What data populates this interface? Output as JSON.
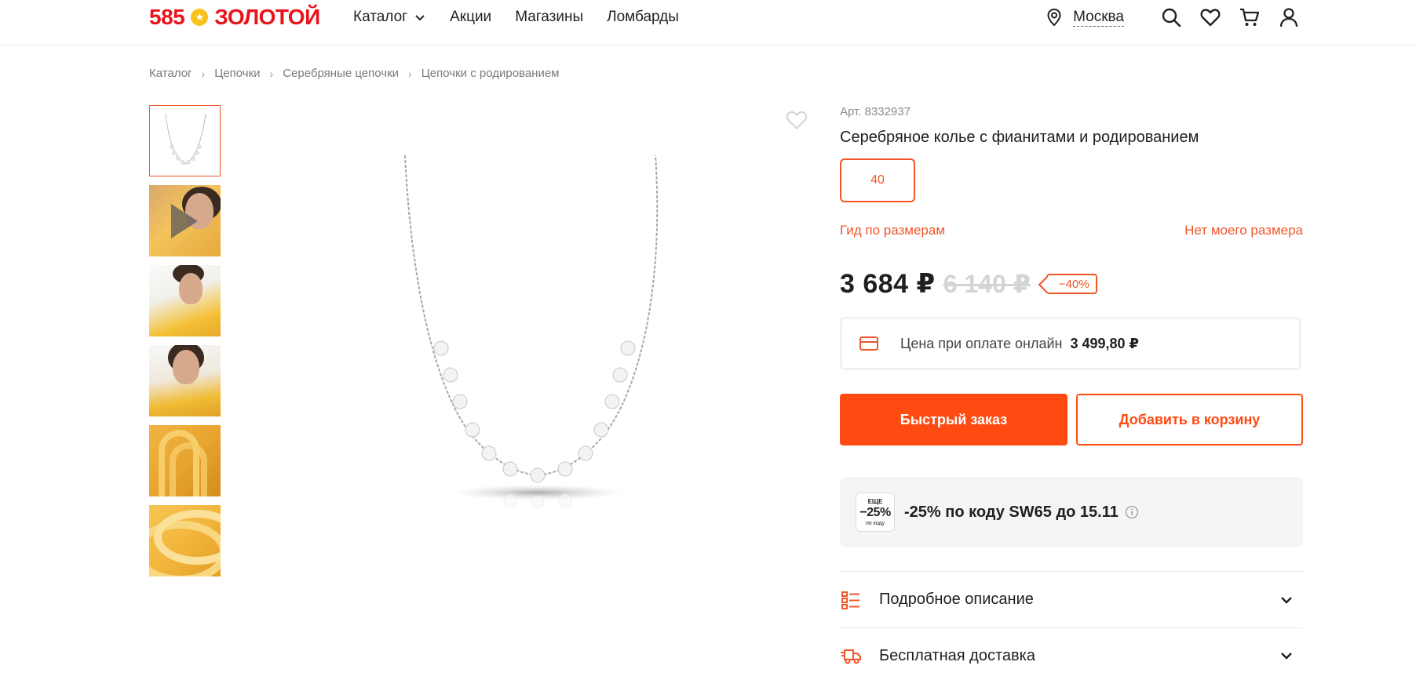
{
  "header": {
    "logo_number": "585",
    "logo_word": "ЗОЛОТОЙ",
    "nav": [
      {
        "label": "Каталог"
      },
      {
        "label": "Акции"
      },
      {
        "label": "Магазины"
      },
      {
        "label": "Ломбарды"
      }
    ],
    "city": "Москва",
    "icons": [
      "location-pin-icon",
      "search-icon",
      "heart-icon",
      "cart-icon",
      "user-icon"
    ]
  },
  "breadcrumb": [
    "Каталог",
    "Цепочки",
    "Серебряные цепочки",
    "Цепочки с родированием"
  ],
  "gallery": {
    "thumbnail_count": 6,
    "active_index": 0,
    "video_thumbnail_index": 1
  },
  "product": {
    "sku": "Арт. 8332937",
    "title": "Серебряное колье с фианитами и родированием",
    "selected_size": "40",
    "size_guide": "Гид по размерам",
    "no_size": "Нет моего размера",
    "price": "3 684 ₽",
    "old_price": "6 140 ₽",
    "discount": "−40%",
    "online_label": "Цена при оплате онлайн",
    "online_price": "3 499,80 ₽",
    "quick_order": "Быстрый заказ",
    "add_to_cart": "Добавить в корзину"
  },
  "promo": {
    "badge_top": "ЕЩЕ",
    "badge_value": "−25%",
    "badge_bottom": "по коду",
    "text": "-25% по коду SW65 до 15.11"
  },
  "accordions": [
    {
      "label": "Подробное описание",
      "icon": "list-icon"
    },
    {
      "label": "Бесплатная доставка",
      "icon": "truck-icon"
    }
  ],
  "colors": {
    "brand_red": "#e8141c",
    "accent_orange": "#ff4a12",
    "coin_gold": "#f7c21c"
  }
}
